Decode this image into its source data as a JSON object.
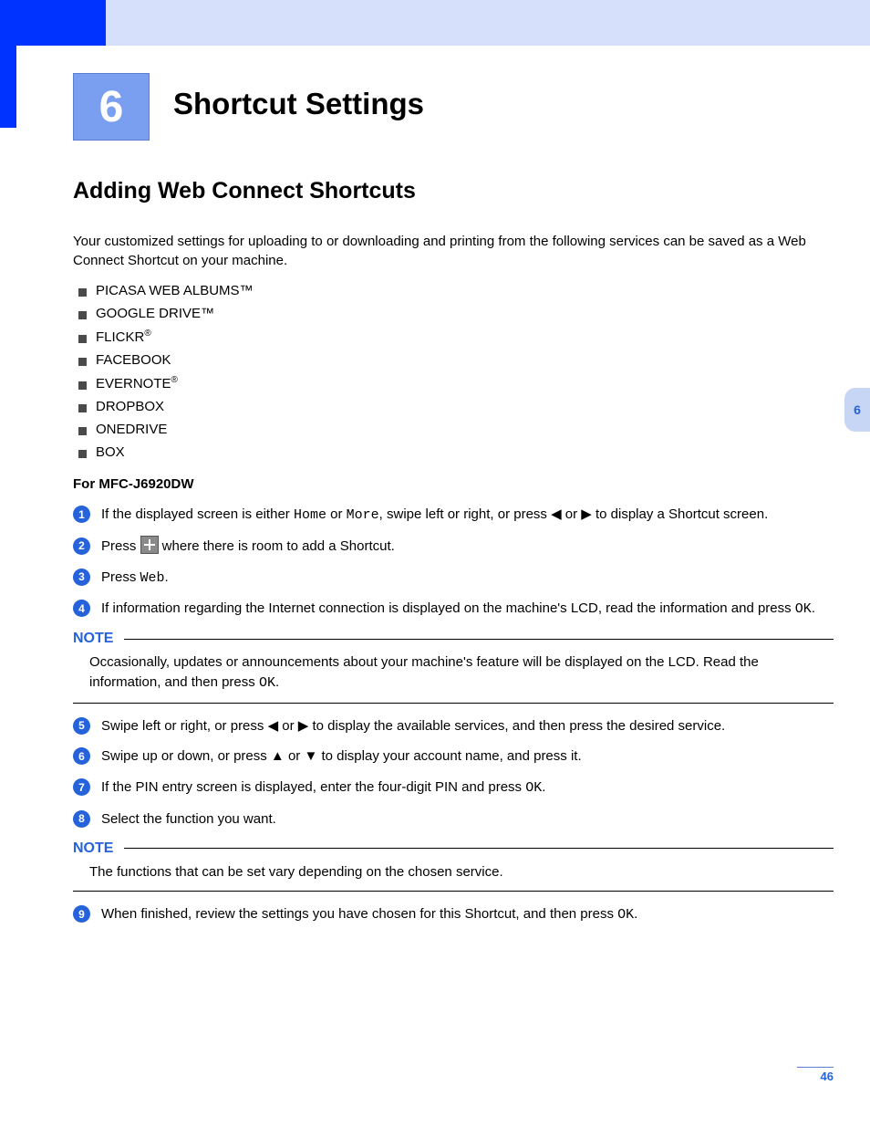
{
  "chapter": {
    "number": "6",
    "title": "Shortcut Settings"
  },
  "section": {
    "heading": "Adding Web Connect Shortcuts"
  },
  "intro": "Your customized settings for uploading to or downloading and printing from the following services can be saved as a Web Connect Shortcut on your machine.",
  "services": [
    "PICASA WEB ALBUMS™",
    "GOOGLE DRIVE™",
    "FLICKR",
    "FACEBOOK",
    "EVERNOTE",
    "DROPBOX",
    "ONEDRIVE",
    "BOX"
  ],
  "model_heading": "For MFC-J6920DW",
  "labels": {
    "home": "Home",
    "more": "More",
    "web": "Web",
    "ok": "OK",
    "note": "NOTE"
  },
  "steps": {
    "s1a": "If the displayed screen is either ",
    "s1b": " or ",
    "s1c": ", swipe left or right, or press ◀ or ▶ to display a Shortcut screen.",
    "s2a": "Press ",
    "s2b": " where there is room to add a Shortcut.",
    "s3a": "Press ",
    "s3b": ".",
    "s4a": "If information regarding the Internet connection is displayed on the machine's LCD, read the information and press ",
    "s4b": ".",
    "s5": "Swipe left or right, or press ◀ or ▶ to display the available services, and then press the desired service.",
    "s6": "Swipe up or down, or press ▲ or ▼ to display your account name, and press it.",
    "s7a": "If the PIN entry screen is displayed, enter the four-digit PIN and press ",
    "s7b": ".",
    "s8": "Select the function you want.",
    "s9a": "When finished, review the settings you have chosen for this Shortcut, and then press ",
    "s9b": "."
  },
  "notes": {
    "n1a": "Occasionally, updates or announcements about your machine's feature will be displayed on the LCD. Read the information, and then press ",
    "n1b": ".",
    "n2": "The functions that can be set vary depending on the chosen service."
  },
  "thumb_tab": "6",
  "page_number": "46"
}
